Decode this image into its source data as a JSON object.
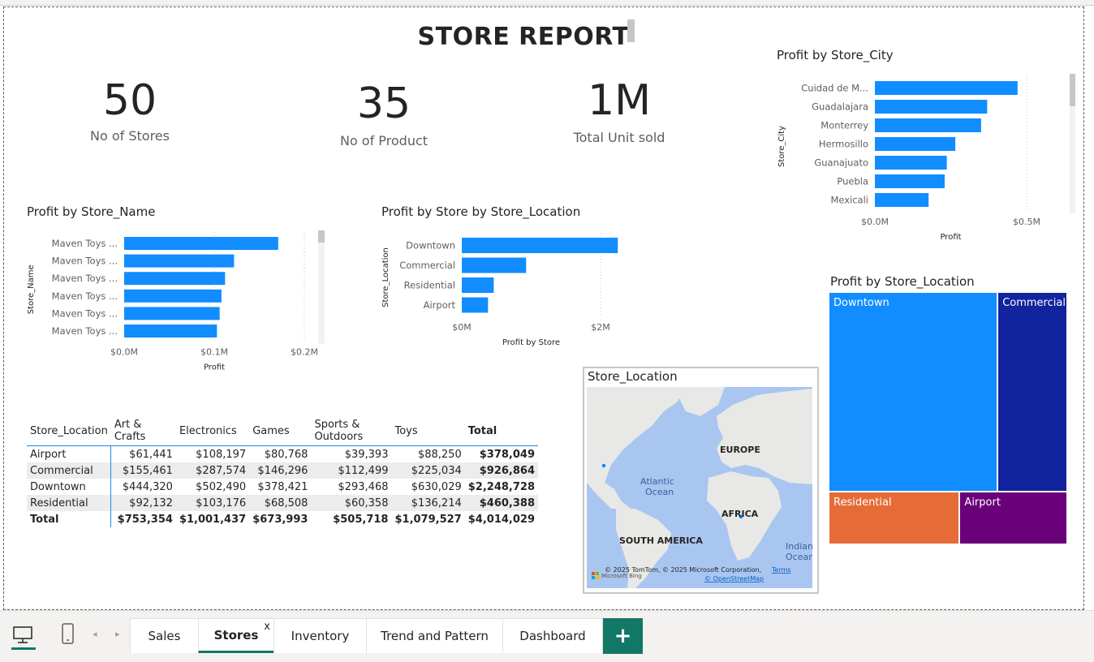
{
  "report": {
    "title": "STORE REPORT"
  },
  "cards": [
    {
      "value": "50",
      "label": "No of Stores"
    },
    {
      "value": "35",
      "label": "No of Product"
    },
    {
      "value": "1M",
      "label": "Total Unit sold"
    }
  ],
  "chart_data": [
    {
      "id": "profit-by-store-name",
      "type": "bar",
      "title": "Profit by Store_Name",
      "xlabel": "Profit",
      "ylabel": "Store_Name",
      "categories": [
        "Maven Toys ...",
        "Maven Toys ...",
        "Maven Toys ...",
        "Maven Toys ...",
        "Maven Toys ...",
        "Maven Toys ..."
      ],
      "values": [
        0.171,
        0.122,
        0.112,
        0.108,
        0.106,
        0.103
      ],
      "value_unit": "M",
      "xlim": [
        0,
        0.2
      ],
      "xticks": [
        "$0.0M",
        "$0.1M",
        "$0.2M"
      ],
      "color": "#118DFF"
    },
    {
      "id": "profit-by-store-location",
      "type": "bar",
      "title": "Profit by Store by Store_Location",
      "xlabel": "Profit by Store",
      "ylabel": "Store_Location",
      "categories": [
        "Downtown",
        "Commercial",
        "Residential",
        "Airport"
      ],
      "values": [
        2.248728,
        0.926864,
        0.460388,
        0.378049
      ],
      "value_unit": "M",
      "xlim": [
        0,
        2.0
      ],
      "xticks": [
        "$0M",
        "$2M"
      ],
      "color": "#118DFF"
    },
    {
      "id": "profit-by-store-city",
      "type": "bar",
      "title": "Profit by Store_City",
      "xlabel": "Profit",
      "ylabel": "Store_City",
      "categories": [
        "Cuidad de M...",
        "Guadalajara",
        "Monterrey",
        "Hermosillo",
        "Guanajuato",
        "Puebla",
        "Mexicali"
      ],
      "values": [
        0.47,
        0.37,
        0.35,
        0.265,
        0.237,
        0.23,
        0.177
      ],
      "value_unit": "M",
      "xlim": [
        0,
        0.5
      ],
      "xticks": [
        "$0.0M",
        "$0.5M"
      ],
      "color": "#118DFF"
    },
    {
      "id": "treemap-store-location",
      "type": "treemap",
      "title": "Profit by Store_Location",
      "categories": [
        "Downtown",
        "Commercial",
        "Residential",
        "Airport"
      ],
      "values": [
        2248728,
        926864,
        460388,
        378049
      ],
      "colors": [
        "#118DFF",
        "#12239E",
        "#E66C37",
        "#6B007B"
      ]
    },
    {
      "id": "matrix-store-location-category",
      "type": "table",
      "columns": [
        "Store_Location",
        "Art & Crafts",
        "Electronics",
        "Games",
        "Sports & Outdoors",
        "Toys",
        "Total"
      ],
      "rows": [
        [
          "Airport",
          "$61,441",
          "$108,197",
          "$80,768",
          "$39,393",
          "$88,250",
          "$378,049"
        ],
        [
          "Commercial",
          "$155,461",
          "$287,574",
          "$146,296",
          "$112,499",
          "$225,034",
          "$926,864"
        ],
        [
          "Downtown",
          "$444,320",
          "$502,490",
          "$378,421",
          "$293,468",
          "$630,029",
          "$2,248,728"
        ],
        [
          "Residential",
          "$92,132",
          "$103,176",
          "$68,508",
          "$60,358",
          "$136,214",
          "$460,388"
        ]
      ],
      "total_row": [
        "Total",
        "$753,354",
        "$1,001,437",
        "$673,993",
        "$505,718",
        "$1,079,527",
        "$4,014,029"
      ]
    }
  ],
  "map": {
    "title": "Store_Location",
    "labels": {
      "europe": "EUROPE",
      "atlantic": "Atlantic",
      "ocean": "Ocean",
      "africa": "AFRICA",
      "south_america": "SOUTH AMERICA",
      "indian": "Indian",
      "indian_ocean": "Ocean"
    },
    "attribution": "© 2025 TomTom, © 2025 Microsoft Corporation,",
    "terms": "Terms",
    "osm": "© OpenStreetMap",
    "bing": "Microsoft Bing",
    "water_color": "#a9c6f1",
    "land_color": "#e8e8e6"
  },
  "bottom_bar": {
    "tabs": [
      "Sales",
      "Stores",
      "Inventory",
      "Trend and Pattern",
      "Dashboard"
    ],
    "active_tab": "Stores",
    "close_glyph": "x",
    "add_glyph": "+"
  }
}
